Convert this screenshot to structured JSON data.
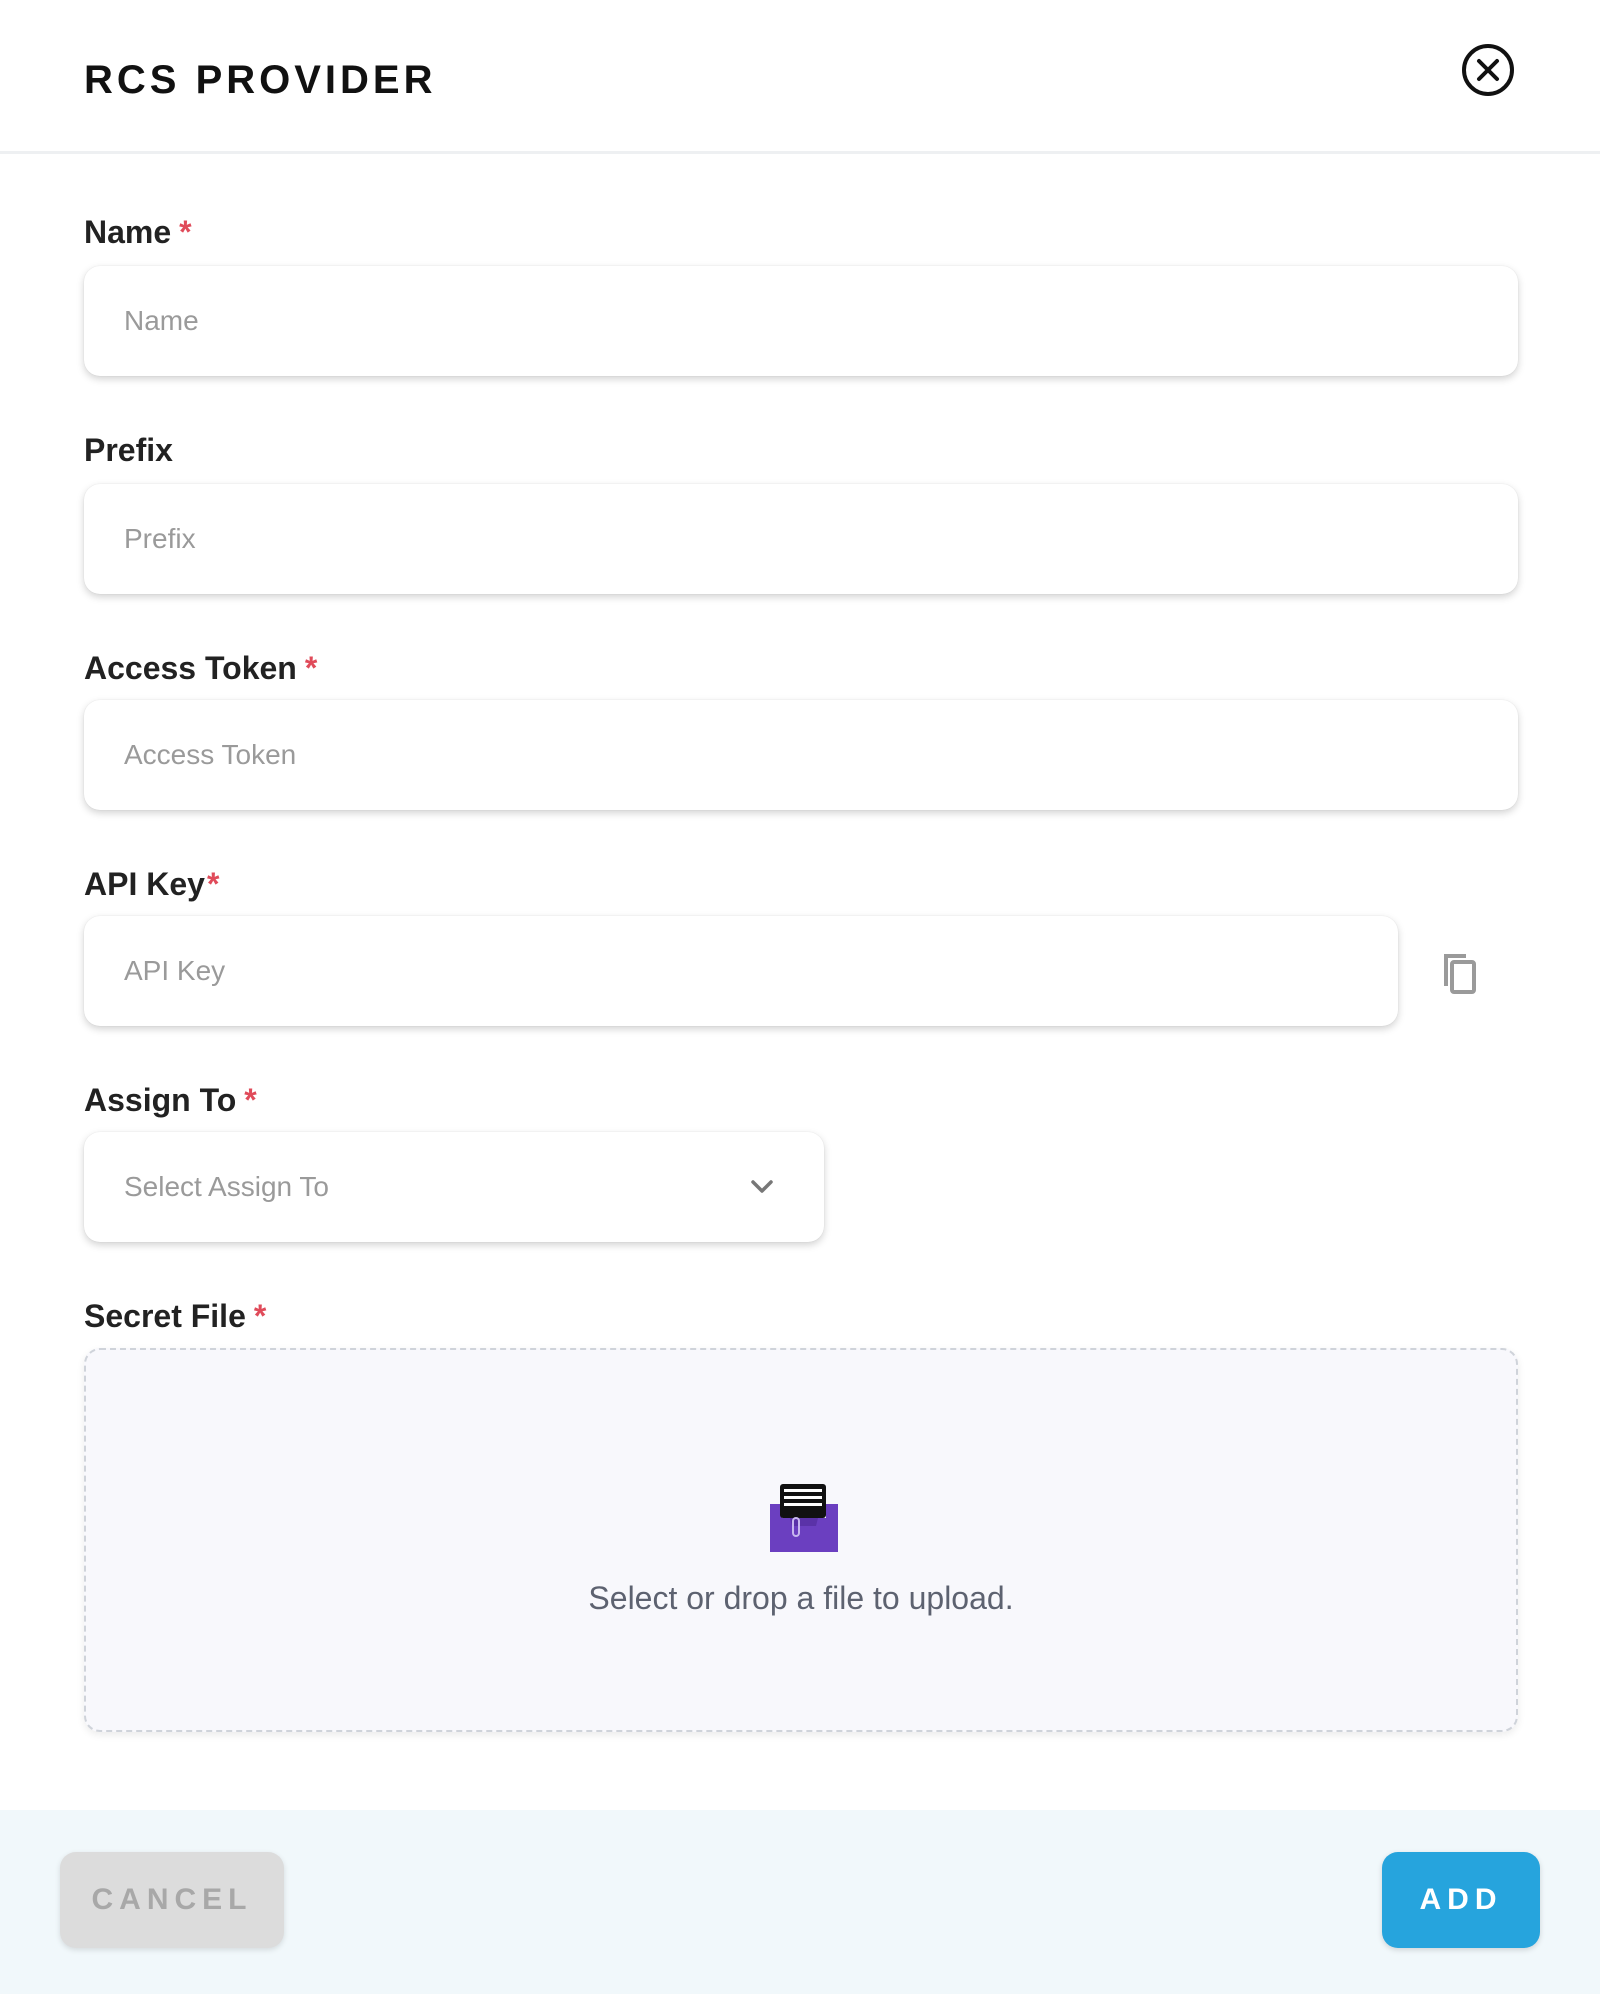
{
  "modal": {
    "title": "RCS PROVIDER"
  },
  "fields": {
    "name": {
      "label": "Name",
      "required_mark": "*",
      "placeholder": "Name",
      "value": ""
    },
    "prefix": {
      "label": "Prefix",
      "placeholder": "Prefix",
      "value": ""
    },
    "access_token": {
      "label": "Access Token",
      "required_mark": "*",
      "placeholder": "Access Token",
      "value": ""
    },
    "api_key": {
      "label": "API Key",
      "required_mark": "*",
      "placeholder": "API Key",
      "value": ""
    },
    "assign_to": {
      "label": "Assign To",
      "required_mark": "*",
      "selected": "Select Assign To"
    },
    "secret_file": {
      "label": "Secret File",
      "required_mark": "*",
      "drop_text": "Select or drop a file to upload."
    }
  },
  "footer": {
    "cancel_label": "CANCEL",
    "add_label": "ADD"
  },
  "icons": {
    "close": "close-circle-icon",
    "copy": "copy-icon",
    "chevron": "chevron-down-icon",
    "upload": "file-upload-icon"
  },
  "colors": {
    "required": "#e04b5a",
    "primary": "#26a4dd",
    "cancel_bg": "#dcdcdc",
    "footer_bg": "#f1f8fb",
    "upload_icon": "#6b3fc0"
  }
}
